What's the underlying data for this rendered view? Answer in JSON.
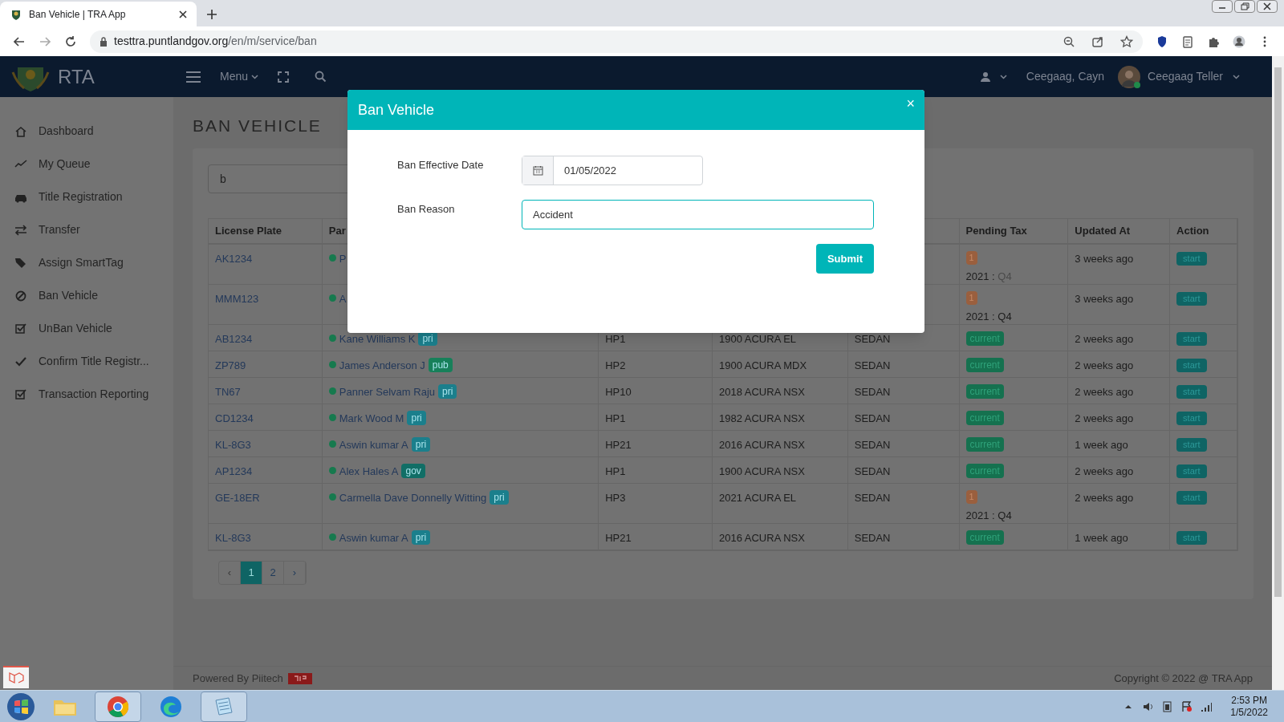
{
  "browser": {
    "tab_title": "Ban Vehicle | TRA App",
    "url_host": "testtra.puntlandgov.org",
    "url_path": "/en/m/service/ban"
  },
  "header": {
    "logo_text": "RTA",
    "menu": "Menu",
    "user_name": "Ceegaag, Cayn",
    "profile_name": "Ceegaag Teller"
  },
  "sidebar": {
    "items": [
      {
        "label": "Dashboard"
      },
      {
        "label": "My Queue"
      },
      {
        "label": "Title Registration"
      },
      {
        "label": "Transfer"
      },
      {
        "label": "Assign SmartTag"
      },
      {
        "label": "Ban Vehicle"
      },
      {
        "label": "UnBan Vehicle"
      },
      {
        "label": "Confirm Title Registr..."
      },
      {
        "label": "Transaction Reporting"
      }
    ]
  },
  "page_title": "BAN VEHICLE",
  "search": {
    "value": "b"
  },
  "table": {
    "columns": [
      "License Plate",
      "Par",
      "Pending Tax",
      "Updated At",
      "Action"
    ],
    "rows": [
      {
        "plate": "AK1234",
        "party": "P",
        "pending": {
          "kind": "due",
          "count": "1",
          "year": "2021 :",
          "quarter": "Q4",
          "quarter_muted": true
        },
        "updated": "3 weeks ago",
        "action": "start"
      },
      {
        "plate": "MMM123",
        "party": "A",
        "pending": {
          "kind": "due",
          "count": "1",
          "year": "2021 :",
          "quarter": "Q4",
          "quarter_muted": false
        },
        "updated": "3 weeks ago",
        "action": "start"
      },
      {
        "plate": "AB1234",
        "party": "Kane Williams K",
        "tag": {
          "label": "pri",
          "color": "#1b7f8c"
        },
        "column_3": "HP1",
        "column_4": "1900 ACURA EL",
        "column_5": "SEDAN",
        "pending": {
          "kind": "current",
          "label": "current"
        },
        "updated": "2 weeks ago",
        "action": "start"
      },
      {
        "plate": "ZP789",
        "party": "James Anderson J",
        "tag": {
          "label": "pub",
          "color": "#17805a"
        },
        "column_3": "HP2",
        "column_4": "1900 ACURA MDX",
        "column_5": "SEDAN",
        "pending": {
          "kind": "current",
          "label": "current"
        },
        "updated": "2 weeks ago",
        "action": "start"
      },
      {
        "plate": "TN67",
        "party": "Panner Selvam Raju",
        "tag": {
          "label": "pri",
          "color": "#1b7f8c"
        },
        "column_3": "HP10",
        "column_4": "2018 ACURA NSX",
        "column_5": "SEDAN",
        "pending": {
          "kind": "current",
          "label": "current"
        },
        "updated": "2 weeks ago",
        "action": "start"
      },
      {
        "plate": "CD1234",
        "party": "Mark Wood M",
        "tag": {
          "label": "pri",
          "color": "#1b7f8c"
        },
        "column_3": "HP1",
        "column_4": "1982 ACURA NSX",
        "column_5": "SEDAN",
        "pending": {
          "kind": "current",
          "label": "current"
        },
        "updated": "2 weeks ago",
        "action": "start"
      },
      {
        "plate": "KL-8G3",
        "party": "Aswin kumar A",
        "tag": {
          "label": "pri",
          "color": "#1b7f8c"
        },
        "column_3": "HP21",
        "column_4": "2016 ACURA NSX",
        "column_5": "SEDAN",
        "pending": {
          "kind": "current",
          "label": "current"
        },
        "updated": "1 week ago",
        "action": "start"
      },
      {
        "plate": "AP1234",
        "party": "Alex Hales A",
        "tag": {
          "label": "gov",
          "color": "#116e66"
        },
        "column_3": "HP1",
        "column_4": "1900 ACURA NSX",
        "column_5": "SEDAN",
        "pending": {
          "kind": "current",
          "label": "current"
        },
        "updated": "2 weeks ago",
        "action": "start"
      },
      {
        "plate": "GE-18ER",
        "party": "Carmella Dave Donnelly Witting",
        "tag": {
          "label": "pri",
          "color": "#1b7f8c"
        },
        "column_3": "HP3",
        "column_4": "2021 ACURA EL",
        "column_5": "SEDAN",
        "pending": {
          "kind": "due",
          "count": "1",
          "year": "2021 :",
          "quarter": "Q4",
          "quarter_muted": false
        },
        "updated": "2 weeks ago",
        "action": "start"
      },
      {
        "plate": "KL-8G3",
        "party": "Aswin kumar A",
        "tag": {
          "label": "pri",
          "color": "#1b7f8c"
        },
        "column_3": "HP21",
        "column_4": "2016 ACURA NSX",
        "column_5": "SEDAN",
        "pending": {
          "kind": "current",
          "label": "current"
        },
        "updated": "1 week ago",
        "action": "start"
      }
    ]
  },
  "pagination": [
    {
      "label": "‹",
      "selected": false,
      "disabled": true
    },
    {
      "label": "1",
      "selected": true,
      "disabled": false
    },
    {
      "label": "2",
      "selected": false,
      "disabled": false
    },
    {
      "label": "›",
      "selected": false,
      "disabled": false
    }
  ],
  "footer": {
    "powered": "Powered By Piitech",
    "copyright": "Copyright © 2022 @ TRA App"
  },
  "modal": {
    "title": "Ban Vehicle",
    "close": "×",
    "fields": [
      {
        "kind": "date",
        "label": "Ban Effective Date",
        "value": "01/05/2022"
      },
      {
        "kind": "text",
        "label": "Ban Reason",
        "value": "Accident"
      }
    ],
    "submit": "Submit"
  },
  "taskbar": {
    "time": "2:53 PM",
    "date": "1/5/2022"
  }
}
